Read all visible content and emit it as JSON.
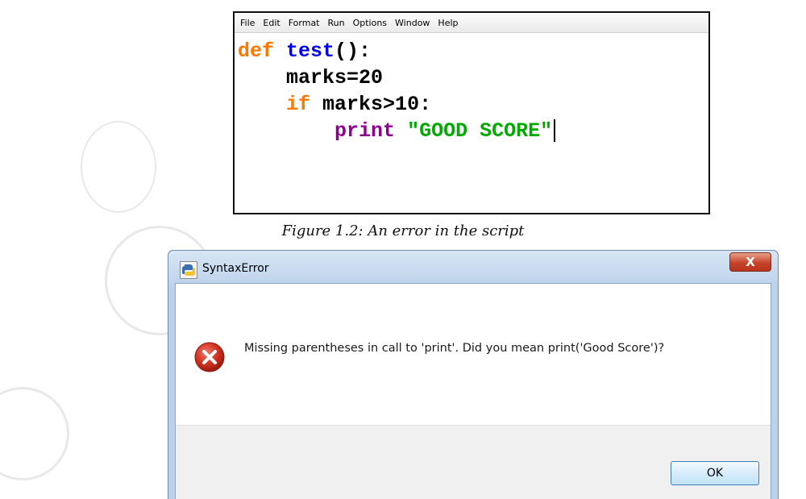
{
  "editor": {
    "menu": [
      "File",
      "Edit",
      "Format",
      "Run",
      "Options",
      "Window",
      "Help"
    ],
    "code": {
      "line1": {
        "kw": "def",
        "fn": "test",
        "rest": "():"
      },
      "line2": {
        "text": "marks=20"
      },
      "line3": {
        "kw": "if",
        "rest": "marks>10:"
      },
      "line4": {
        "builtin": "print",
        "string": "\"GOOD SCORE\""
      }
    }
  },
  "caption": "Figure 1.2:  An error in the script",
  "dialog": {
    "title": "SyntaxError",
    "close_label": "X",
    "message": "Missing parentheses in call to 'print'. Did you mean print('Good Score')?",
    "ok_label": "OK"
  },
  "colors": {
    "keyword": "#ff7700",
    "function": "#0000ff",
    "builtin": "#900090",
    "string": "#00aa00",
    "close_button": "#c6432a",
    "dialog_frame": "#bcd2ea"
  },
  "icons": {
    "app": "python-icon",
    "error": "error-icon",
    "close": "close-icon"
  }
}
